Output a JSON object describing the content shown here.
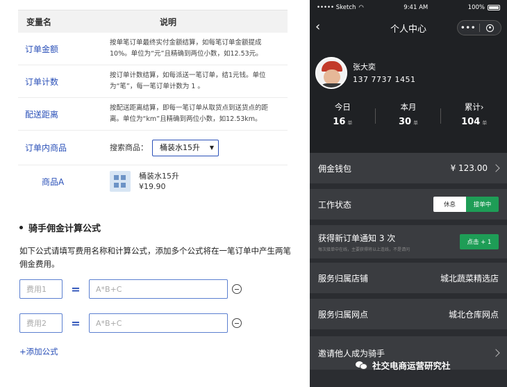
{
  "left": {
    "table_header": {
      "col1": "变量名",
      "col2": "说明"
    },
    "rows": [
      {
        "name": "订单金额",
        "desc": "按单笔订单最终实付金额结算，如每笔订单金额提成10%。单位为“元”且精确到两位小数，如12.53元。"
      },
      {
        "name": "订单计数",
        "desc": "按订单计数结算，如每派送一笔订单，结1元钱。单位为“笔”，每一笔订单计数为 1 。"
      },
      {
        "name": "配送距离",
        "desc": "按配送距离结算，即每一笔订单从取货点到送货点的距离。单位为“km”且精确到两位小数，如12.53km。"
      }
    ],
    "product_row": {
      "name": "订单内商品",
      "search_label": "搜索商品：",
      "select_value": "桶装水15升"
    },
    "product_a": {
      "name": "商品A",
      "product_name": "桶装水15升",
      "price": "¥19.90"
    },
    "section": {
      "title": "骑手佣金计算公式",
      "desc": "如下公式请填写费用名称和计算公式，添加多个公式将在一笔订单中产生两笔佣金费用。"
    },
    "formulas": [
      {
        "name_placeholder": "费用1",
        "expr_placeholder": "A*B+C"
      },
      {
        "name_placeholder": "费用2",
        "expr_placeholder": "A*B+C"
      }
    ],
    "eq_sign": "=",
    "add_formula": "+添加公式"
  },
  "phone": {
    "status": {
      "carrier": "••••• Sketch",
      "time": "9:41 AM",
      "battery": "100%"
    },
    "nav": {
      "title": "个人中心",
      "dots": "•••"
    },
    "user": {
      "name": "张大奕",
      "phone": "137 7737 1451"
    },
    "stats": [
      {
        "label": "今日",
        "value": "16",
        "unit": "单"
      },
      {
        "label": "本月",
        "value": "30",
        "unit": "单"
      },
      {
        "label": "累计",
        "value": "104",
        "unit": "单"
      }
    ],
    "wallet": {
      "label": "佣金钱包",
      "amount": "¥ 123.00"
    },
    "work": {
      "label": "工作状态",
      "off": "休息",
      "on": "接单中"
    },
    "notify": {
      "label": "获得新订单通知 3 次",
      "sub": "每次接单中在线，主要获得将以上连线，不是请问",
      "button": "点击 + 1"
    },
    "store": {
      "label": "服务归属店铺",
      "value": "城北蔬菜精选店"
    },
    "outlet": {
      "label": "服务归属网点",
      "value": "城北仓库网点"
    },
    "invite": {
      "label": "邀请他人成为骑手"
    },
    "accent_green": "#1e9d56",
    "bg_dark": "#1f2124"
  },
  "watermark": {
    "text": "社交电商运营研究社"
  }
}
